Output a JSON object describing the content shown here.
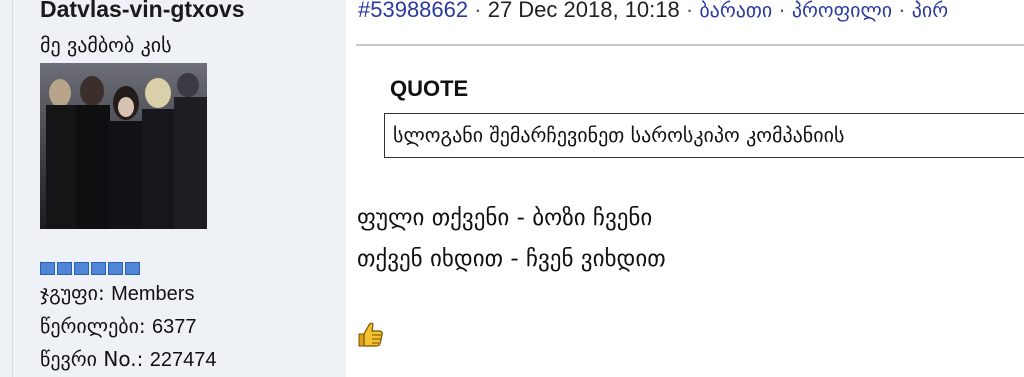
{
  "sidebar": {
    "username": "Datvlas-vin-gtxovs",
    "title": "მე ვამბობ კის",
    "rank_pips": 6,
    "colors": {
      "rank": "#4f86d6",
      "background": "#eef2f7"
    },
    "stats": {
      "group_label": "ჯგუფი:",
      "group_value": "Members",
      "posts_label": "წერილები:",
      "posts_value": "6377",
      "member_label": "წევრი No.:",
      "member_value": "227474"
    }
  },
  "post": {
    "id": "#53988662",
    "date": "27 Dec 2018, 10:18",
    "links": [
      "ბარათი",
      "პროფილი",
      "პირ"
    ],
    "quote_label": "QUOTE",
    "quote_text": "სლოგანი შემარჩევინეთ საროსკიპო კომპანიის",
    "body_line1": "ფული თქვენი - ბოზი ჩვენი",
    "body_line2": "თქვენ იხდით - ჩვენ ვიხდით",
    "emoji": "thumbs-up-emoji",
    "link_color": "#2a3aa0"
  }
}
